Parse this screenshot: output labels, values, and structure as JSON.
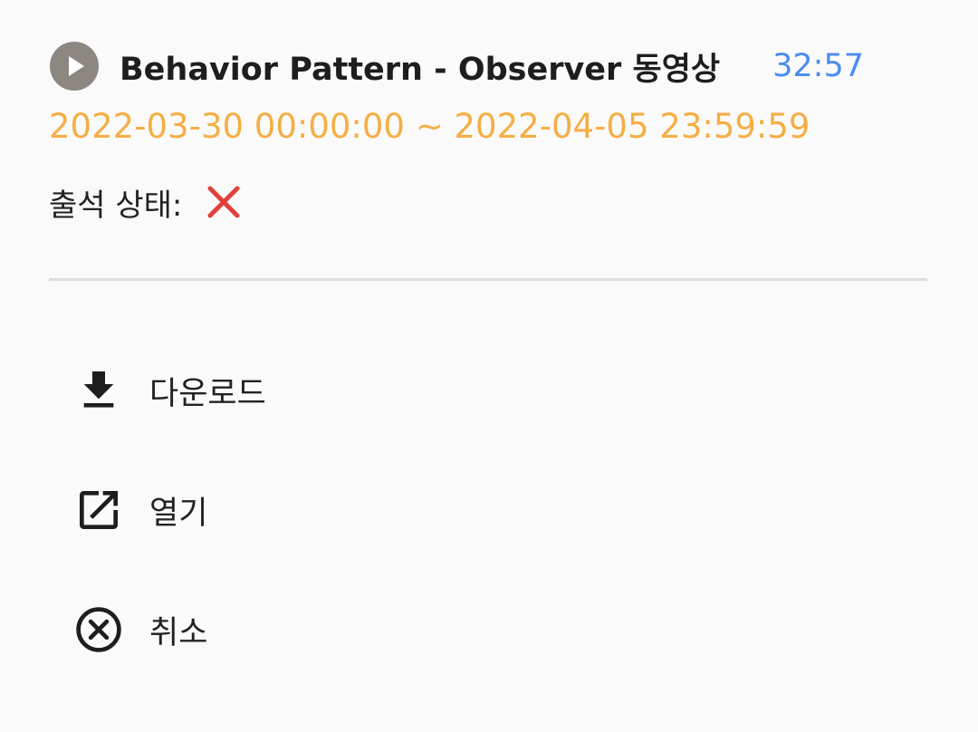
{
  "video": {
    "title": "Behavior Pattern - Observer 동영상",
    "duration": "32:57",
    "period": "2022-03-30 00:00:00 ~ 2022-04-05 23:59:59",
    "play_icon": "play-circle-icon"
  },
  "attendance": {
    "label": "출석 상태:",
    "status_icon": "red-x-icon"
  },
  "actions": [
    {
      "label": "다운로드",
      "icon": "download-icon"
    },
    {
      "label": "열기",
      "icon": "open-in-new-icon"
    },
    {
      "label": "취소",
      "icon": "cancel-circle-icon"
    }
  ],
  "colors": {
    "duration": "#4a8cf0",
    "period": "#f5ae45",
    "status_mark": "#e0403a",
    "play_icon": "#8d8782",
    "divider": "#dddddd"
  }
}
